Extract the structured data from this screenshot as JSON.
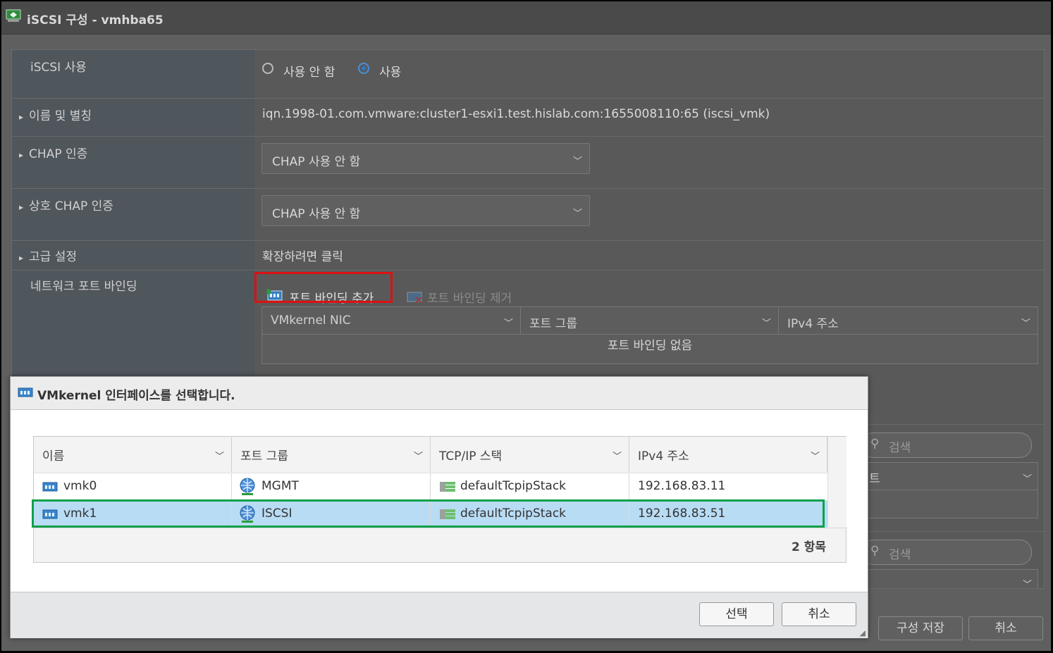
{
  "window": {
    "title": "iSCSI 구성 - vmhba65"
  },
  "form": {
    "iscsi": {
      "label": "iSCSI 사용",
      "opt_off": "사용 안 함",
      "opt_on": "사용"
    },
    "name": {
      "label": "이름 및 별칭",
      "value": "iqn.1998-01.com.vmware:cluster1-esxi1.test.hislab.com:1655008110:65 (iscsi_vmk)"
    },
    "chap": {
      "label": "CHAP 인증",
      "value": "CHAP 사용 안 함"
    },
    "mutual_chap": {
      "label": "상호 CHAP 인증",
      "value": "CHAP 사용 안 함"
    },
    "advanced": {
      "label": "고급 설정",
      "value": "확장하려면 클릭"
    },
    "binding": {
      "label": "네트워크 포트 바인딩",
      "add_label": "포트 바인딩 추가",
      "remove_label": "포트 바인딩 제거",
      "columns": [
        "VMkernel NIC",
        "포트 그룹",
        "IPv4 주소"
      ],
      "empty": "포트 바인딩 없음"
    },
    "search_placeholder": "검색",
    "partial_col": "트"
  },
  "footer": {
    "save_label": "구성 저장",
    "cancel_label": "취소"
  },
  "dialog": {
    "title": "VMkernel 인터페이스를 선택합니다.",
    "columns": [
      "이름",
      "포트 그룹",
      "TCP/IP 스택",
      "IPv4 주소"
    ],
    "rows": [
      {
        "name": "vmk0",
        "portgroup": "MGMT",
        "stack": "defaultTcpipStack",
        "ip": "192.168.83.11"
      },
      {
        "name": "vmk1",
        "portgroup": "ISCSI",
        "stack": "defaultTcpipStack",
        "ip": "192.168.83.51"
      }
    ],
    "count": "2 항목",
    "select_label": "선택",
    "cancel_label": "취소"
  }
}
